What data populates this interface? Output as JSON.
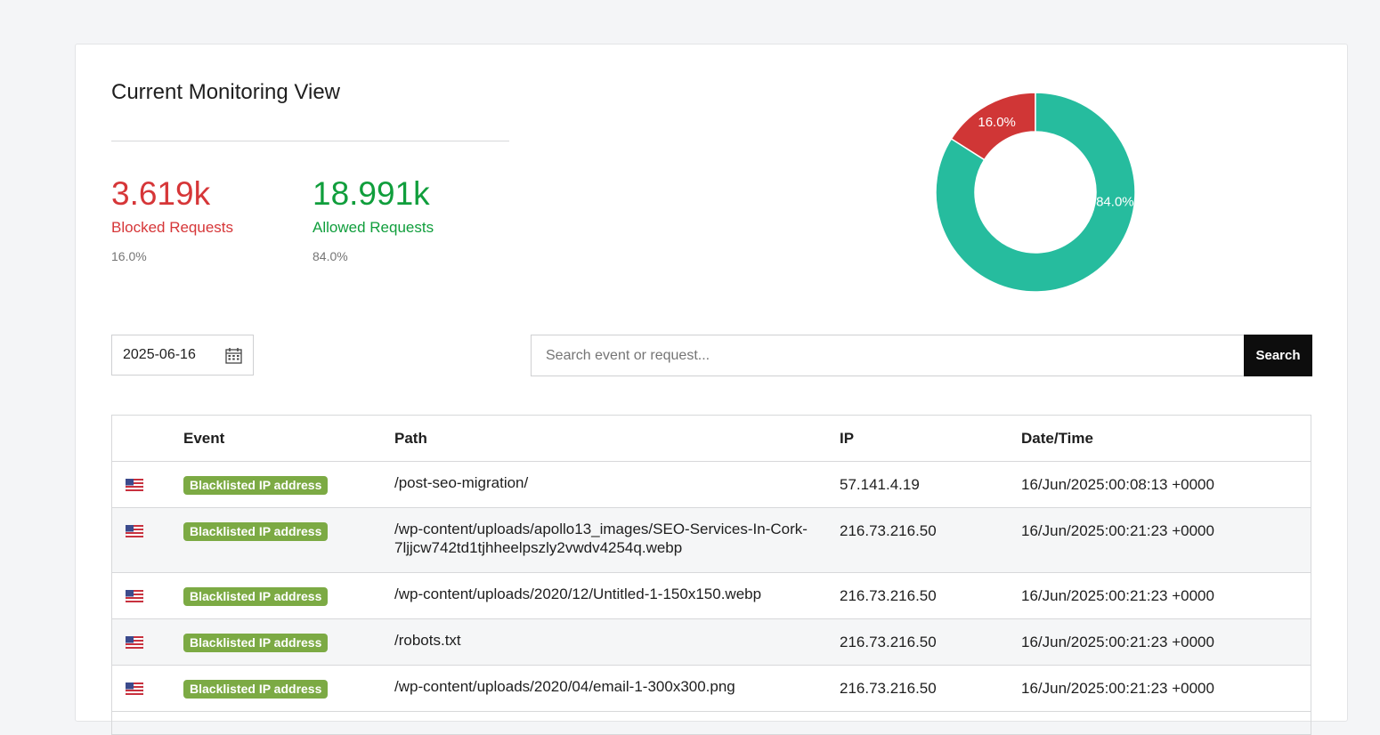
{
  "title": "Current Monitoring View",
  "stats": {
    "blocked": {
      "value": "3.619k",
      "label": "Blocked Requests",
      "percent": "16.0%",
      "color": "#d63638"
    },
    "allowed": {
      "value": "18.991k",
      "label": "Allowed Requests",
      "percent": "84.0%",
      "color": "#109e3c"
    }
  },
  "chart_data": {
    "type": "pie",
    "donut": true,
    "categories": [
      "Blocked Requests",
      "Allowed Requests"
    ],
    "values": [
      16.0,
      84.0
    ],
    "labels": [
      "16.0%",
      "84.0%"
    ],
    "colors": [
      "#d03636",
      "#26bc9e"
    ]
  },
  "filters": {
    "date": "2025-06-16",
    "search_placeholder": "Search event or request...",
    "search_value": "",
    "search_button": "Search"
  },
  "table": {
    "headers": [
      "",
      "Event",
      "Path",
      "IP",
      "Date/Time"
    ],
    "rows": [
      {
        "flag": "us-flag-icon",
        "event": "Blacklisted IP address",
        "path": "/post-seo-migration/",
        "ip": "57.141.4.19",
        "datetime": "16/Jun/2025:00:08:13 +0000"
      },
      {
        "flag": "us-flag-icon",
        "event": "Blacklisted IP address",
        "path": "/wp-content/uploads/apollo13_images/SEO-Services-In-Cork-7ljjcw742td1tjhheelpszly2vwdv4254q.webp",
        "ip": "216.73.216.50",
        "datetime": "16/Jun/2025:00:21:23 +0000"
      },
      {
        "flag": "us-flag-icon",
        "event": "Blacklisted IP address",
        "path": "/wp-content/uploads/2020/12/Untitled-1-150x150.webp",
        "ip": "216.73.216.50",
        "datetime": "16/Jun/2025:00:21:23 +0000"
      },
      {
        "flag": "us-flag-icon",
        "event": "Blacklisted IP address",
        "path": "/robots.txt",
        "ip": "216.73.216.50",
        "datetime": "16/Jun/2025:00:21:23 +0000"
      },
      {
        "flag": "us-flag-icon",
        "event": "Blacklisted IP address",
        "path": "/wp-content/uploads/2020/04/email-1-300x300.png",
        "ip": "216.73.216.50",
        "datetime": "16/Jun/2025:00:21:23 +0000"
      }
    ]
  }
}
